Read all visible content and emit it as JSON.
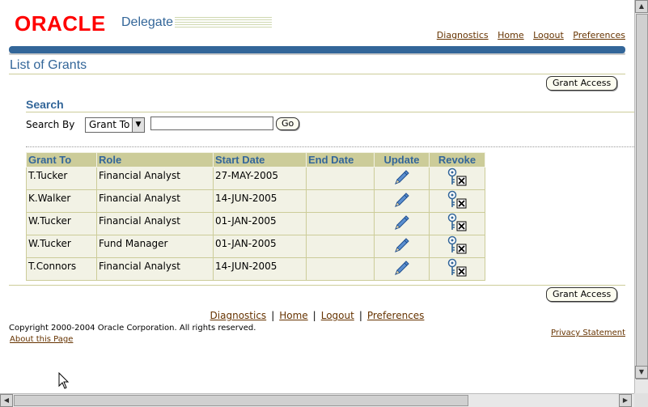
{
  "header": {
    "logo": "ORACLE",
    "app_name": "Delegate",
    "links": [
      "Diagnostics",
      "Home",
      "Logout",
      "Preferences"
    ]
  },
  "page_title": "List of Grants",
  "grant_access_label": "Grant Access",
  "search": {
    "title": "Search",
    "search_by_label": "Search By",
    "select_value": "Grant To",
    "input_value": "",
    "go_label": "Go"
  },
  "table": {
    "headers": [
      "Grant To",
      "Role",
      "Start Date",
      "End Date",
      "Update",
      "Revoke"
    ],
    "rows": [
      {
        "grant_to": "T.Tucker",
        "role": "Financial Analyst",
        "start_date": "27-MAY-2005",
        "end_date": ""
      },
      {
        "grant_to": "K.Walker",
        "role": "Financial Analyst",
        "start_date": "14-JUN-2005",
        "end_date": ""
      },
      {
        "grant_to": "W.Tucker",
        "role": "Financial Analyst",
        "start_date": "01-JAN-2005",
        "end_date": ""
      },
      {
        "grant_to": "W.Tucker",
        "role": "Fund Manager",
        "start_date": "01-JAN-2005",
        "end_date": ""
      },
      {
        "grant_to": "T.Connors",
        "role": "Financial Analyst",
        "start_date": "14-JUN-2005",
        "end_date": ""
      }
    ]
  },
  "footer": {
    "links": [
      "Diagnostics",
      "Home",
      "Logout",
      "Preferences"
    ],
    "separator": "|",
    "copyright": "Copyright 2000-2004 Oracle Corporation. All rights reserved.",
    "about": "About this Page",
    "privacy": "Privacy Statement"
  },
  "colors": {
    "brand_red": "#ff0000",
    "accent_blue": "#336699",
    "table_header": "#cccc99",
    "table_cell": "#f2f2e5",
    "link": "#663300"
  },
  "icons": {
    "update": "pencil-icon",
    "revoke": "key-delete-icon"
  }
}
